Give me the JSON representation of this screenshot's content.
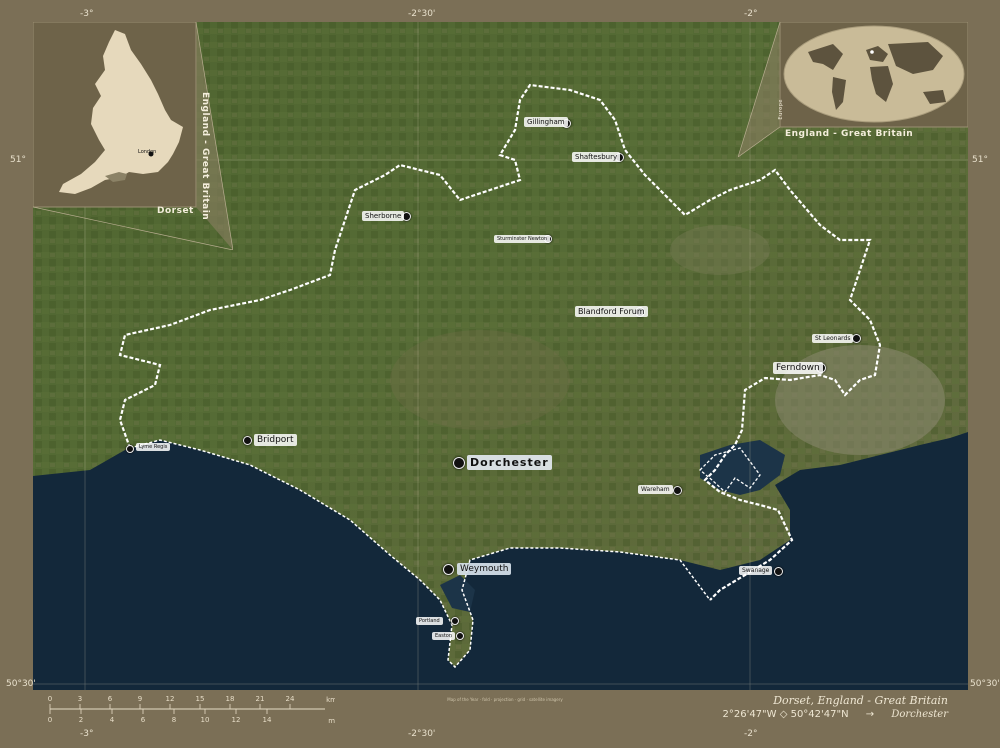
{
  "map": {
    "title": "Dorset, England - Great Britain",
    "coordinates": "2°26'47\"W ◇ 50°42'47\"N",
    "arrow": "→",
    "capital_label": "Dorchester",
    "graticule": {
      "top": [
        "-3°",
        "-2°30'",
        "-2°"
      ],
      "left": [
        "51°",
        "50°30'"
      ],
      "right": [
        "51°",
        "50°30'"
      ],
      "bottom": [
        "-3°",
        "-2°30'",
        "-2°"
      ]
    },
    "scale": {
      "km_unit": "km",
      "mi_unit": "mi",
      "km_ticks": [
        "0",
        "3",
        "6",
        "9",
        "12",
        "15",
        "18",
        "21",
        "24"
      ],
      "mi_ticks": [
        "0",
        "2",
        "4",
        "6",
        "8",
        "10",
        "12",
        "14"
      ]
    },
    "credit": "Map of the Year · fold · projection · grid · satellite imagery",
    "cities": [
      {
        "name": "Dorchester",
        "size": "capital"
      },
      {
        "name": "Weymouth",
        "size": "large"
      },
      {
        "name": "Ferndown",
        "size": "medium"
      },
      {
        "name": "Bridport",
        "size": "medium"
      },
      {
        "name": "Blandford Forum",
        "size": "medium"
      },
      {
        "name": "Shaftesbury",
        "size": "small"
      },
      {
        "name": "Gillingham",
        "size": "small"
      },
      {
        "name": "Sherborne",
        "size": "small"
      },
      {
        "name": "Sturminster Newton",
        "size": "small"
      },
      {
        "name": "St Leonards",
        "size": "small"
      },
      {
        "name": "Wareham",
        "size": "small"
      },
      {
        "name": "Swanage",
        "size": "small"
      },
      {
        "name": "Lyme Regis",
        "size": "small"
      },
      {
        "name": "Portland",
        "size": "small"
      },
      {
        "name": "Easton",
        "size": "small"
      }
    ]
  },
  "inset_left": {
    "vertical_title": "England - Great Britain",
    "region_label": "Dorset",
    "capital_label": "London"
  },
  "inset_right": {
    "title": "England - Great Britain",
    "continent_label": "Europe"
  },
  "colors": {
    "frame": "#7b6f56",
    "sea": "#13283a",
    "land": "#4d5d2e",
    "border": "#ffffff"
  }
}
